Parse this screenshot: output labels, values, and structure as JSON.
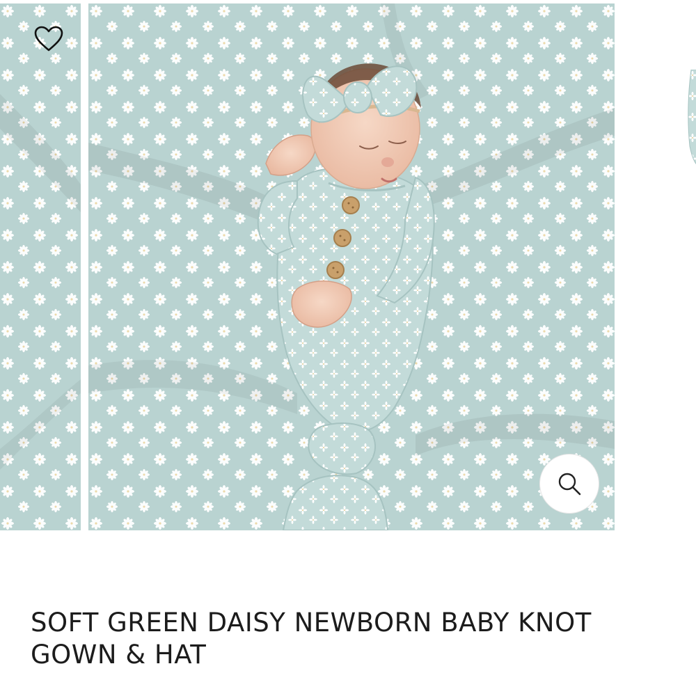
{
  "product": {
    "title": "SOFT GREEN DAISY NEWBORN BABY KNOT GOWN & HAT"
  },
  "gallery": {
    "slides": [
      {
        "name": "previous-slide",
        "image": "daisy-print-fabric"
      },
      {
        "name": "current-slide",
        "image": "newborn-in-daisy-knot-gown-with-bow-headband"
      },
      {
        "name": "next-slide",
        "image": "daisy-print-fabric"
      }
    ],
    "wishlist_icon": "heart-outline-icon",
    "zoom_icon": "magnifier-icon"
  },
  "colors": {
    "fabric": "#b9d3d1",
    "daisy": "#ffffff",
    "title_text": "#1c1c1c"
  }
}
